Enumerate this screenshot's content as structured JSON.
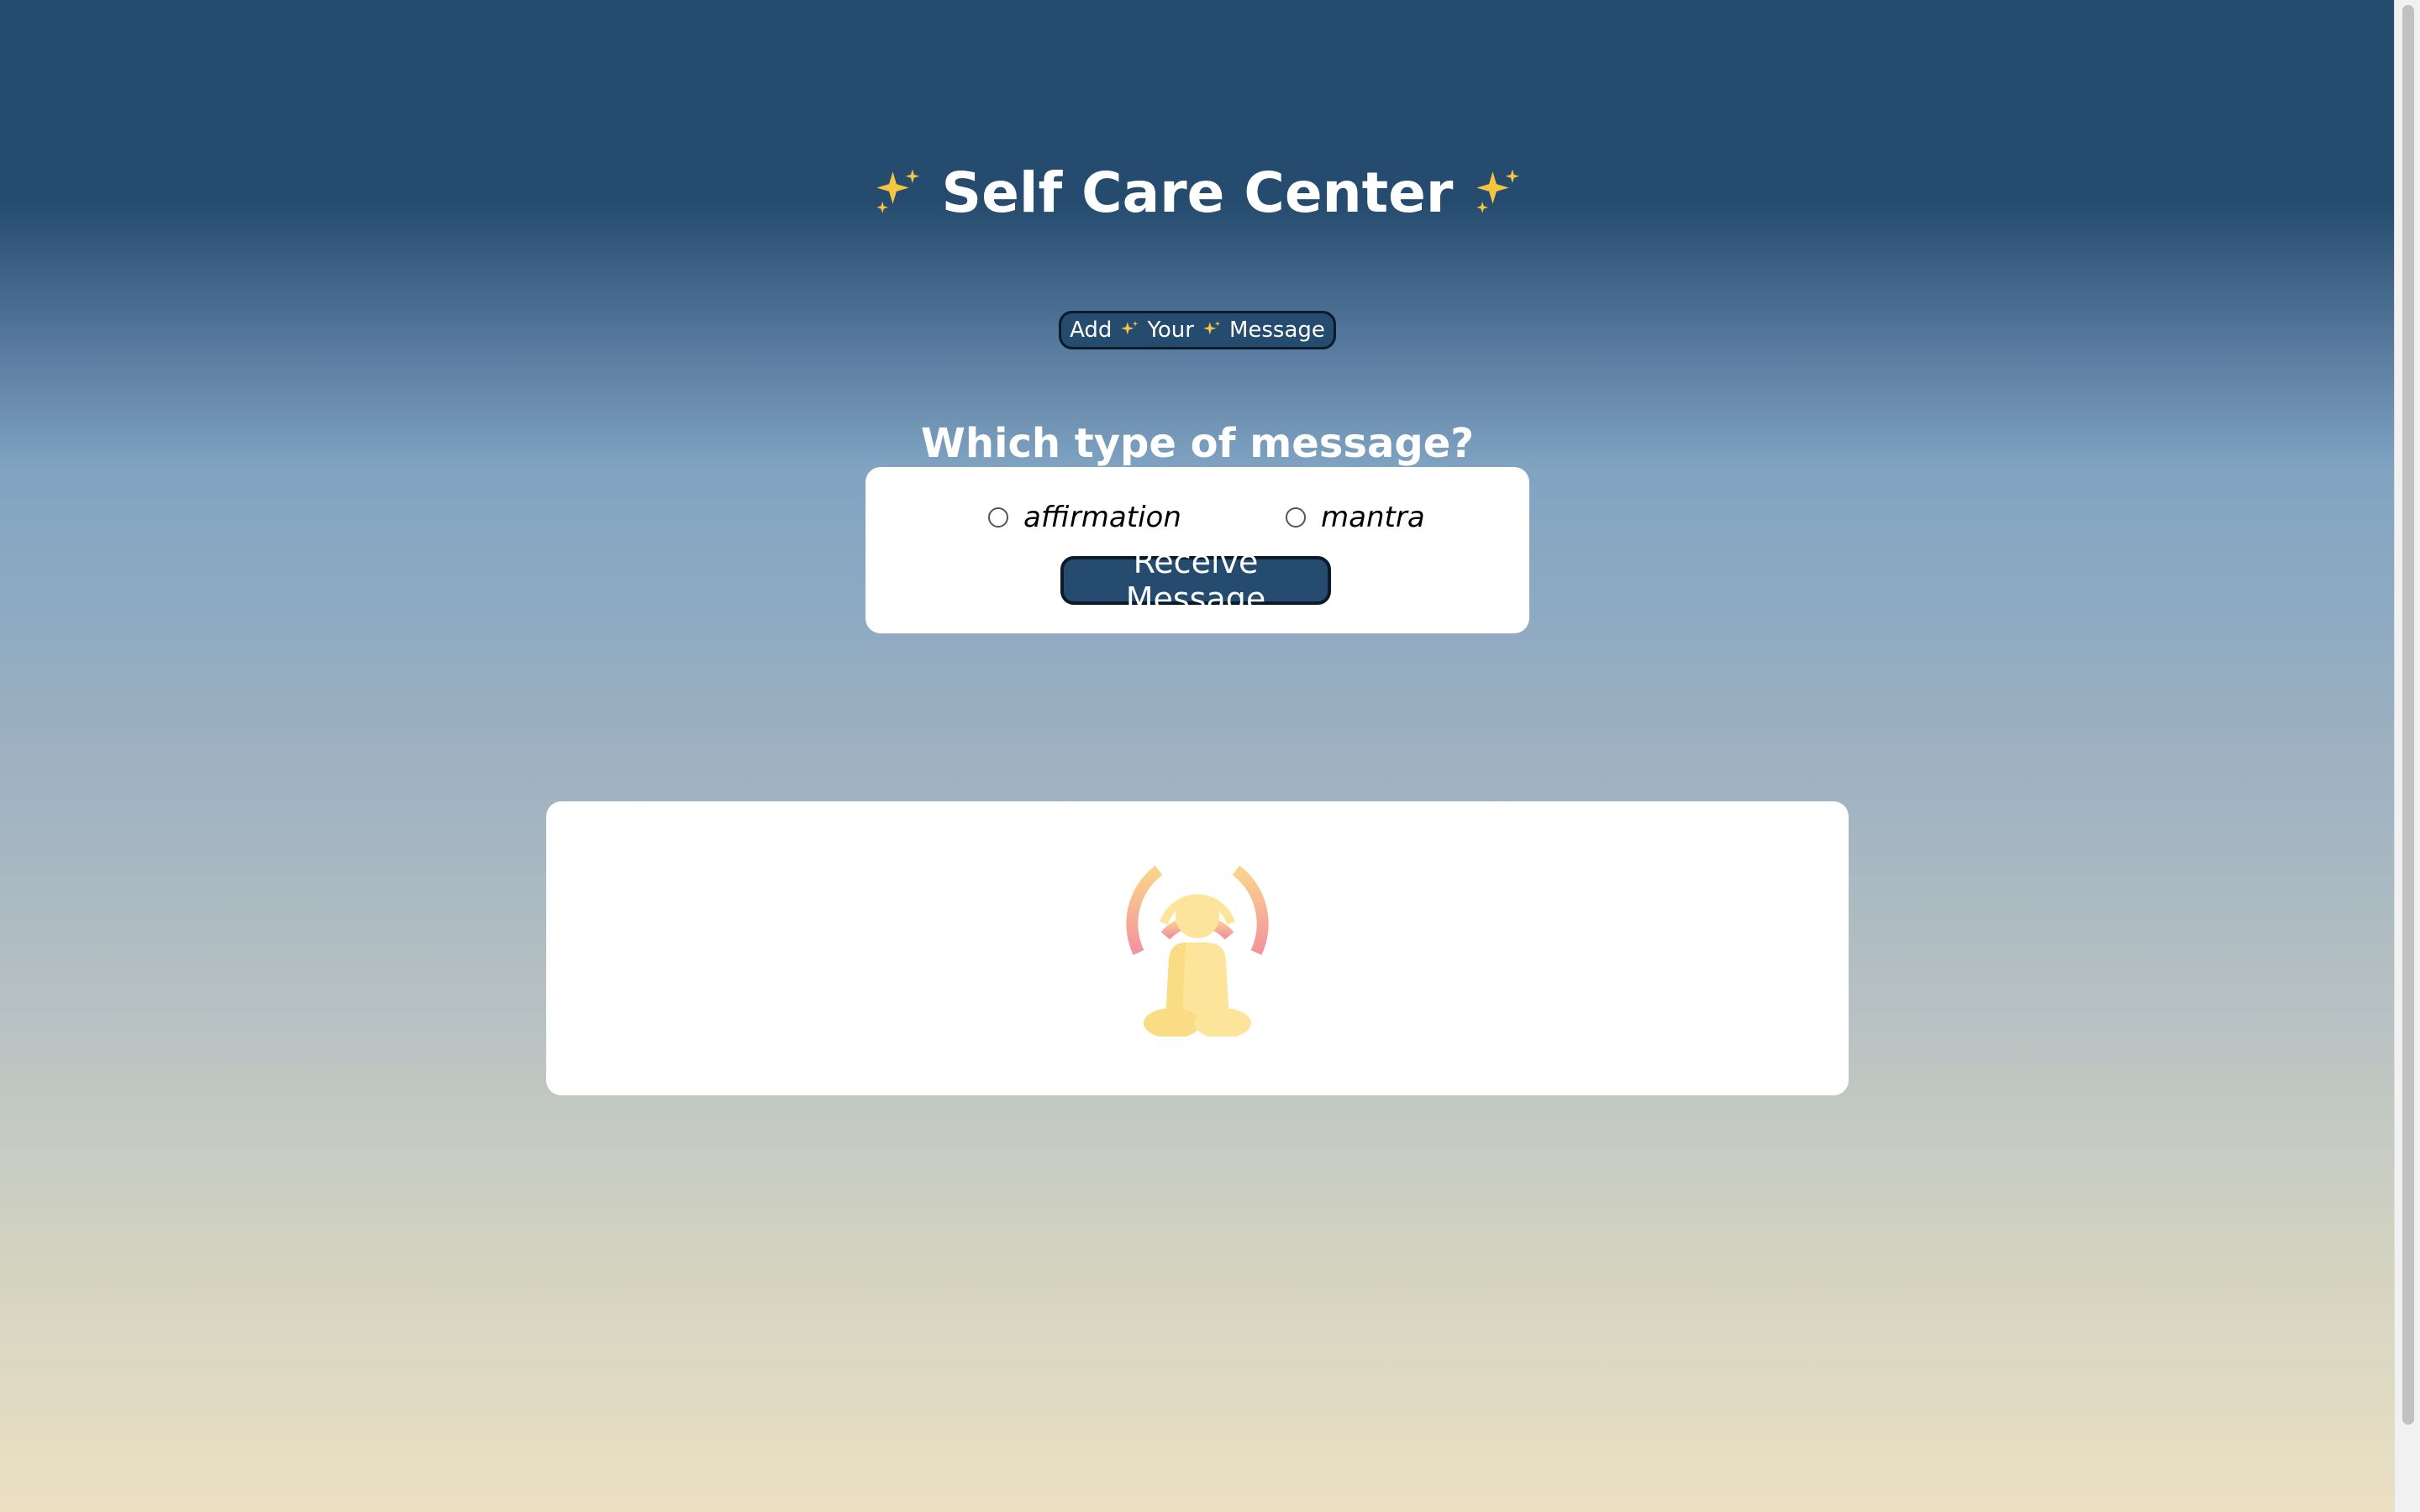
{
  "header": {
    "title": "Self Care Center",
    "decoration_icon": "sparkles-icon"
  },
  "add_message_button": {
    "words": [
      "Add",
      "Your",
      "Message"
    ],
    "icon": "sparkles-icon"
  },
  "question": "Which type of message?",
  "message_type": {
    "options": [
      {
        "label": "affirmation",
        "selected": false
      },
      {
        "label": "mantra",
        "selected": false
      }
    ],
    "button_label": "Receive Message"
  },
  "message_area": {
    "icon": "meditation-icon"
  },
  "colors": {
    "primary": "#254b6f",
    "button_border": "#0b1b2b",
    "card": "#ffffff",
    "sparkle": "#f5c542",
    "icon_yellow": "#fde49b",
    "icon_pink": "#f3a1a8"
  }
}
